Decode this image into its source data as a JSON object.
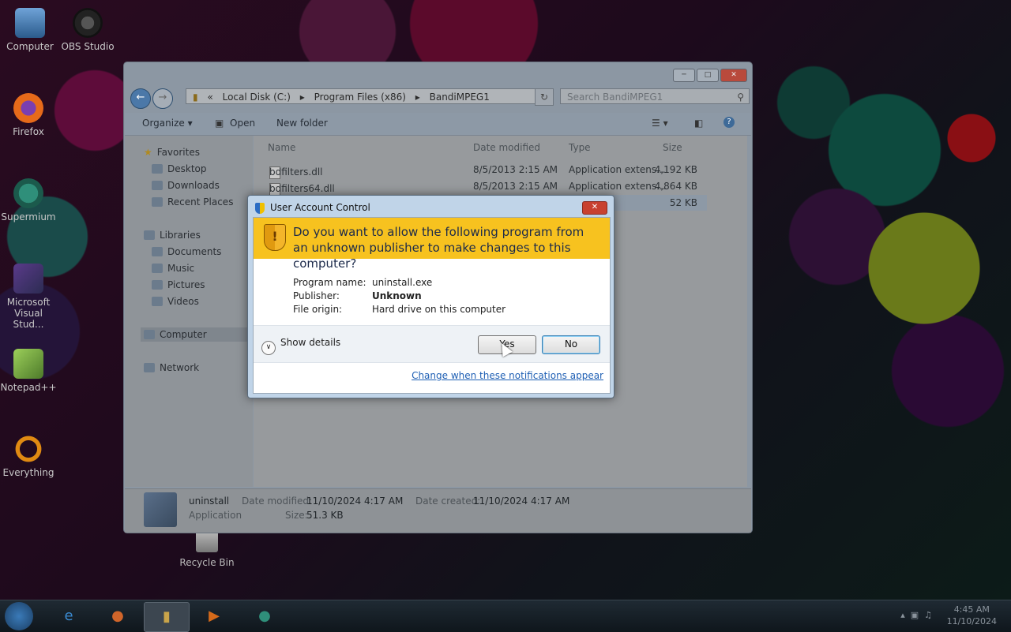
{
  "desktop": {
    "icons": [
      {
        "label": "Computer"
      },
      {
        "label": "OBS Studio"
      },
      {
        "label": "Firefox"
      },
      {
        "label": "Supermium"
      },
      {
        "label": "Microsoft Visual Stud..."
      },
      {
        "label": "Notepad++"
      },
      {
        "label": "Everything"
      },
      {
        "label": "Recycle Bin"
      }
    ]
  },
  "explorer": {
    "breadcrumb": [
      "Local Disk (C:)",
      "Program Files (x86)",
      "BandiMPEG1"
    ],
    "search_placeholder": "Search BandiMPEG1",
    "toolbar": {
      "organize": "Organize",
      "open": "Open",
      "new_folder": "New folder"
    },
    "nav": {
      "favorites": "Favorites",
      "desktop": "Desktop",
      "downloads": "Downloads",
      "recent": "Recent Places",
      "libraries": "Libraries",
      "documents": "Documents",
      "music": "Music",
      "pictures": "Pictures",
      "videos": "Videos",
      "computer": "Computer",
      "network": "Network"
    },
    "columns": {
      "name": "Name",
      "date": "Date modified",
      "type": "Type",
      "size": "Size"
    },
    "files": [
      {
        "name": "bdfilters.dll",
        "date": "8/5/2013 2:15 AM",
        "type": "Application extens...",
        "size": "4,192 KB"
      },
      {
        "name": "bdfilters64.dll",
        "date": "8/5/2013 2:15 AM",
        "type": "Application extens...",
        "size": "4,864 KB"
      },
      {
        "name": "",
        "date": "",
        "type": "",
        "size": "52 KB"
      }
    ],
    "details": {
      "name": "uninstall",
      "kind": "Application",
      "date_modified_label": "Date modified:",
      "date_modified": "11/10/2024 4:17 AM",
      "date_created_label": "Date created:",
      "date_created": "11/10/2024 4:17 AM",
      "size_label": "Size:",
      "size": "51.3 KB"
    }
  },
  "uac": {
    "title": "User Account Control",
    "question": "Do you want to allow the following program from an unknown publisher to make changes to this computer?",
    "program_label": "Program name:",
    "program": "uninstall.exe",
    "publisher_label": "Publisher:",
    "publisher": "Unknown",
    "origin_label": "File origin:",
    "origin": "Hard drive on this computer",
    "show_details": "Show details",
    "yes": "Yes",
    "no": "No",
    "link": "Change when these notifications appear"
  },
  "taskbar": {
    "time": "4:45 AM",
    "date": "11/10/2024"
  }
}
